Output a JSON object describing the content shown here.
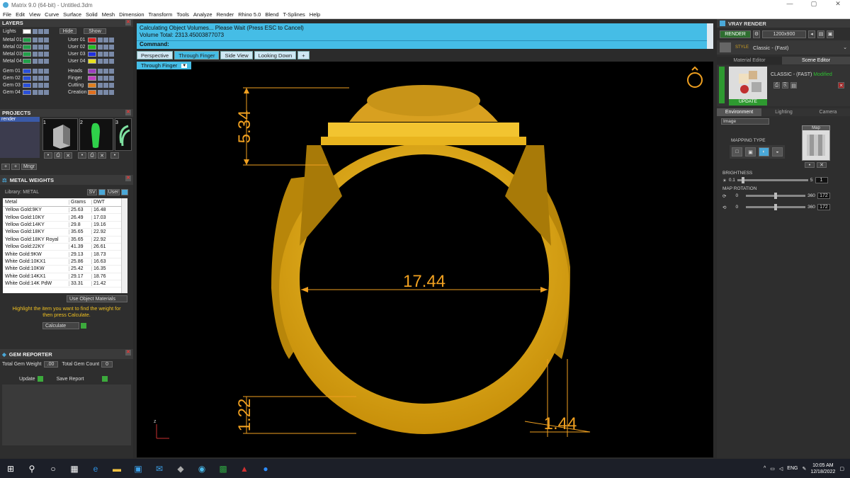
{
  "window": {
    "title": "Matrix 9.0 (64-bit) - Untitled.3dm",
    "controls": [
      "—",
      "▢",
      "✕"
    ]
  },
  "menu": [
    "File",
    "Edit",
    "View",
    "Curve",
    "Surface",
    "Solid",
    "Mesh",
    "Dimension",
    "Transform",
    "Tools",
    "Analyze",
    "Render",
    "Rhino 5.0",
    "Blend",
    "T-Splines",
    "Help"
  ],
  "layers": {
    "title": "LAYERS",
    "lights": "Lights",
    "hide": "Hide",
    "show": "Show",
    "rows_left": [
      {
        "label": "Metal 01",
        "color": "#22a04a"
      },
      {
        "label": "Metal 02",
        "color": "#22a04a"
      },
      {
        "label": "Metal 03",
        "color": "#22a04a"
      },
      {
        "label": "Metal 04",
        "color": "#22a04a"
      },
      {
        "label": "Gem 01",
        "color": "#2a50d8"
      },
      {
        "label": "Gem 02",
        "color": "#2a50d8"
      },
      {
        "label": "Gem 03",
        "color": "#2a50d8"
      },
      {
        "label": "Gem 04",
        "color": "#2a50d8"
      }
    ],
    "rows_right": [
      {
        "label": "User 01",
        "color": "#e02020"
      },
      {
        "label": "User 02",
        "color": "#20c020"
      },
      {
        "label": "User 03",
        "color": "#2030e0"
      },
      {
        "label": "User 04",
        "color": "#e8e020"
      },
      {
        "label": "Heads",
        "color": "#9a40c0"
      },
      {
        "label": "Finger",
        "color": "#c040c0"
      },
      {
        "label": "Cutting",
        "color": "#e08020"
      },
      {
        "label": "Creation",
        "color": "#e07020"
      }
    ]
  },
  "projects": {
    "title": "PROJECTS",
    "item": "render",
    "thumbs": [
      "1",
      "2",
      "3"
    ],
    "mngr": "Mngr"
  },
  "metal_weights": {
    "title": "METAL WEIGHTS",
    "library": "Library: METAL",
    "sv": "SV",
    "user": "User",
    "headers": [
      "Metal",
      "Grams",
      "DWT"
    ],
    "rows": [
      [
        "Yellow Gold:9KY",
        "25.63",
        "16.48"
      ],
      [
        "Yellow Gold:10KY",
        "26.49",
        "17.03"
      ],
      [
        "Yellow Gold:14KY",
        "29.8",
        "19.16"
      ],
      [
        "Yellow Gold:18KY",
        "35.65",
        "22.92"
      ],
      [
        "Yellow Gold:18KY Royal",
        "35.65",
        "22.92"
      ],
      [
        "Yellow Gold:22KY",
        "41.39",
        "26.61"
      ],
      [
        "White Gold:9KW",
        "29.13",
        "18.73"
      ],
      [
        "White Gold:10KX1",
        "25.86",
        "16.63"
      ],
      [
        "White Gold:10KW",
        "25.42",
        "16.35"
      ],
      [
        "White Gold:14KX1",
        "29.17",
        "18.76"
      ],
      [
        "White Gold:14K PdW",
        "33.31",
        "21.42"
      ]
    ],
    "use_object_materials": "Use Object Materials",
    "hint": "Highlight the item you want to find the weight for then press Calculate.",
    "calculate": "Calculate"
  },
  "gem_reporter": {
    "title": "GEM REPORTER",
    "total_weight_label": "Total Gem Weight",
    "total_weight": ".00",
    "total_count_label": "Total Gem Count",
    "total_count": "0",
    "update": "Update",
    "save": "Save Report"
  },
  "status": {
    "line1": "Calculating Object Volumes... Please Wait (Press ESC to Cancel)",
    "line2": "Volume Total: 2313.45003877073",
    "command": "Command:"
  },
  "viewport_tabs": [
    "Perspective",
    "Through Finger",
    "Side View",
    "Looking Down",
    "+"
  ],
  "viewport": {
    "name": "Through Finger",
    "dims": {
      "top": "5.34",
      "inner": "17.44",
      "bottom": "1.22",
      "side": "1.44"
    },
    "axis": "z"
  },
  "vray": {
    "title": "VRAY RENDER",
    "render": "RENDER",
    "size": "1200x900",
    "style_label": "STYLE",
    "style": "Classic - (Fast)",
    "tabs": [
      "Material Editor",
      "Scene Editor"
    ],
    "preset": "CLASSIC - (FAST)",
    "modified": "Modified",
    "update": "UPDATE",
    "subtabs": [
      "Environment",
      "Lighting",
      "Camera"
    ],
    "env_select": "Image",
    "mapping_type": "MAPPING TYPE",
    "map": "Map",
    "brightness": "BRIGHTNESS",
    "bright_min": "0.1",
    "bright_max": "5",
    "bright_val": "1",
    "map_rotation": "MAP ROTATION",
    "rot1": {
      "min": "0",
      "max": "360",
      "val": "172"
    },
    "rot2": {
      "min": "0",
      "max": "360",
      "val": "172"
    }
  },
  "taskbar": {
    "time": "10:05 AM",
    "date": "12/18/2022",
    "lang": "ENG"
  },
  "colors": {
    "gold": "#e8b41e",
    "dim": "#f0a020",
    "accent": "#45bde6"
  }
}
